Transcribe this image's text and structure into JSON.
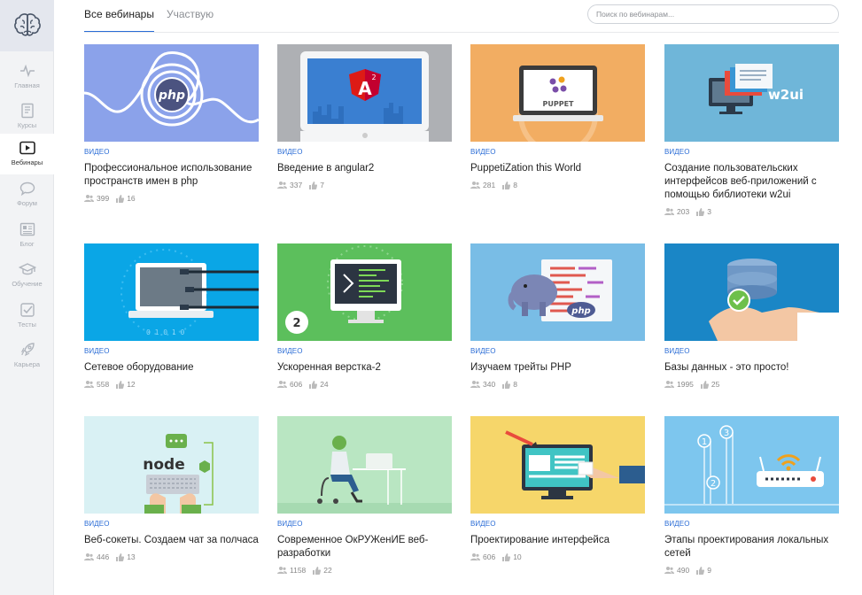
{
  "sidebar": {
    "items": [
      {
        "label": "Главная",
        "icon": "pulse-icon"
      },
      {
        "label": "Курсы",
        "icon": "book-icon"
      },
      {
        "label": "Вебинары",
        "icon": "play-icon",
        "active": true
      },
      {
        "label": "Форум",
        "icon": "chat-icon"
      },
      {
        "label": "Блог",
        "icon": "newspaper-icon"
      },
      {
        "label": "Обучение",
        "icon": "graduation-cap-icon"
      },
      {
        "label": "Тесты",
        "icon": "checkbox-icon"
      },
      {
        "label": "Карьера",
        "icon": "rocket-icon"
      }
    ]
  },
  "tabs": [
    {
      "label": "Все вебинары",
      "active": true
    },
    {
      "label": "Участвую",
      "active": false
    }
  ],
  "search": {
    "placeholder": "Поиск по вебинарам..."
  },
  "cards": [
    {
      "type": "ВИДЕО",
      "title": "Профессиональное использование пространств имен в php",
      "participants": "399",
      "likes": "16"
    },
    {
      "type": "ВИДЕО",
      "title": "Введение в angular2",
      "participants": "337",
      "likes": "7"
    },
    {
      "type": "ВИДЕО",
      "title": "PuppetiZation this World",
      "participants": "281",
      "likes": "8"
    },
    {
      "type": "ВИДЕО",
      "title": "Создание пользовательских интерфейсов веб-приложений с помощью библиотеки w2ui",
      "participants": "203",
      "likes": "3"
    },
    {
      "type": "ВИДЕО",
      "title": "Сетевое оборудование",
      "participants": "558",
      "likes": "12"
    },
    {
      "type": "ВИДЕО",
      "title": "Ускоренная верстка-2",
      "participants": "606",
      "likes": "24"
    },
    {
      "type": "ВИДЕО",
      "title": "Изучаем трейты PHP",
      "participants": "340",
      "likes": "8"
    },
    {
      "type": "ВИДЕО",
      "title": "Базы данных - это просто!",
      "participants": "1995",
      "likes": "25"
    },
    {
      "type": "ВИДЕО",
      "title": "Веб-сокеты. Создаем чат за полчаса",
      "participants": "446",
      "likes": "13"
    },
    {
      "type": "ВИДЕО",
      "title": "Современное ОкРУЖенИЕ веб-разработки",
      "participants": "1158",
      "likes": "22"
    },
    {
      "type": "ВИДЕО",
      "title": "Проектирование интерфейса",
      "participants": "606",
      "likes": "10"
    },
    {
      "type": "ВИДЕО",
      "title": "Этапы проектирования локальных сетей",
      "participants": "490",
      "likes": "9"
    }
  ],
  "thumb_text": {
    "php": "php",
    "angular_mark": "A",
    "angular_sup": "2",
    "puppet": "PUPPET",
    "w2ui": "w2ui",
    "bits": "0 1 0 1 0",
    "step2": "2",
    "node": "node",
    "php2": "php",
    "n1": "1",
    "n2": "2",
    "n3": "3"
  },
  "colors": {
    "accent": "#2a6cd6",
    "thumb_php": "#8ba2ea",
    "thumb_angular": "#aeb0b4",
    "thumb_puppet": "#f2ad62",
    "thumb_w2ui": "#6fb6d9",
    "thumb_network": "#0aa6e6",
    "thumb_layout": "#5cbf5c",
    "thumb_traits": "#79bde6",
    "thumb_db": "#1a86c6",
    "thumb_ws": "#d9f1f4",
    "thumb_env": "#b9e6c2",
    "thumb_ui": "#f6d66a",
    "thumb_lan": "#7dc6ee"
  }
}
